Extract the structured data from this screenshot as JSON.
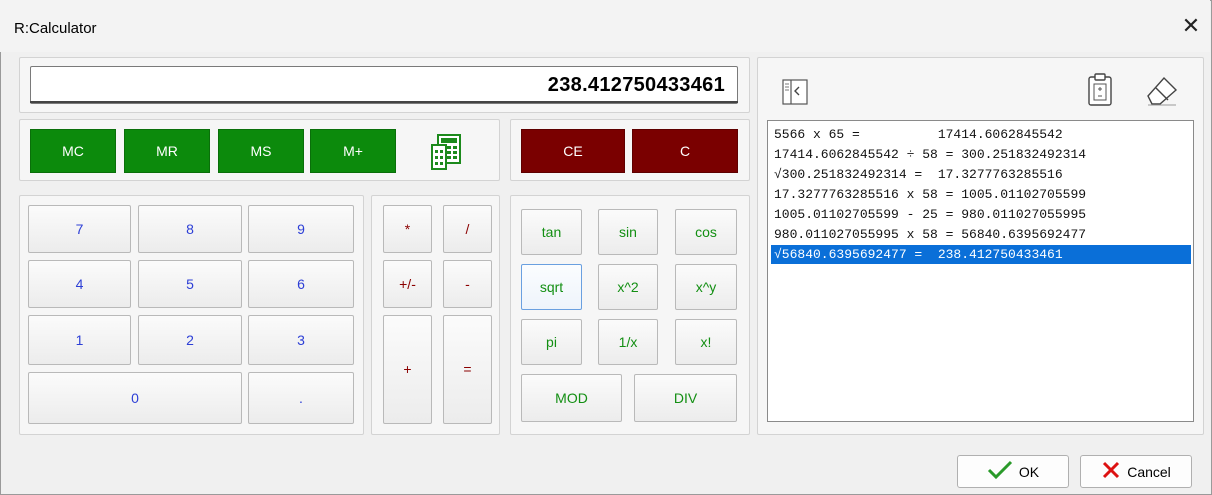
{
  "window": {
    "title": "R:Calculator"
  },
  "display": {
    "value": "238.412750433461"
  },
  "memory": {
    "buttons": [
      "MC",
      "MR",
      "MS",
      "M+"
    ]
  },
  "clear": {
    "ce": "CE",
    "c": "C"
  },
  "numpad": {
    "k7": "7",
    "k8": "8",
    "k9": "9",
    "k4": "4",
    "k5": "5",
    "k6": "6",
    "k1": "1",
    "k2": "2",
    "k3": "3",
    "k0": "0",
    "dot": "."
  },
  "operators": {
    "mul": "*",
    "div": "/",
    "neg": "+/-",
    "sub": "-",
    "add": "+",
    "eq": "="
  },
  "functions": {
    "tan": "tan",
    "sin": "sin",
    "cos": "cos",
    "sqrt": "sqrt",
    "sq": "x^2",
    "pow": "x^y",
    "pi": "pi",
    "inv": "1/x",
    "fact": "x!",
    "mod": "MOD",
    "idiv": "DIV"
  },
  "history": [
    "5566 x 65 =          17414.6062845542",
    "17414.6062845542 ÷ 58 = 300.251832492314",
    "√300.251832492314 =  17.3277763285516",
    "17.3277763285516 x 58 = 1005.01102705599",
    "1005.01102705599 - 25 = 980.011027055995",
    "980.011027055995 x 58 = 56840.6395692477",
    "√56840.6395692477 =  238.412750433461"
  ],
  "history_selected_index": 6,
  "footer": {
    "ok": "OK",
    "cancel": "Cancel"
  },
  "colors": {
    "memory_green": "#0c8a0c",
    "clear_red": "#7a0000",
    "selection_blue": "#0a6fd8",
    "digit_blue": "#2d3fd6",
    "operator_red": "#8b0000",
    "function_green": "#138f13"
  },
  "icons": {
    "panel_toggle": "panel-collapse-icon",
    "copy": "clipboard-icon",
    "eraser": "eraser-icon",
    "memory_calc": "calculator-icon"
  }
}
